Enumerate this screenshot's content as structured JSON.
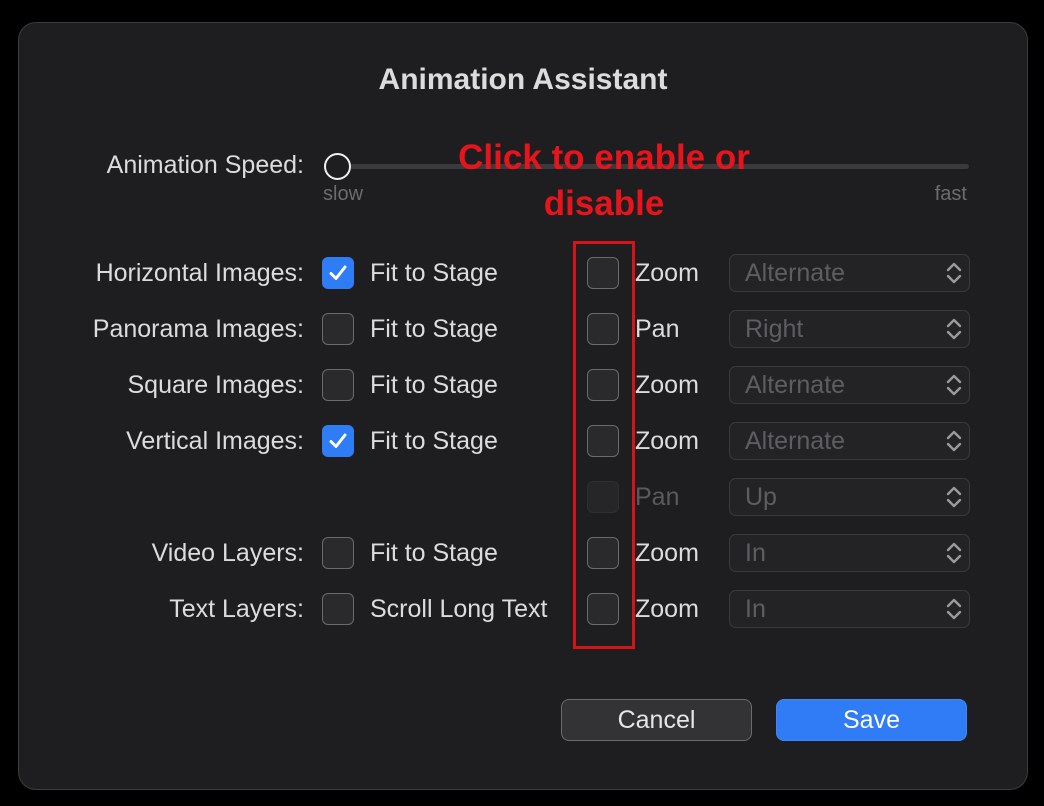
{
  "dialog": {
    "title": "Animation Assistant",
    "speed_label": "Animation Speed:",
    "speed_min_label": "slow",
    "speed_max_label": "fast",
    "speed_value": 0.0,
    "annotation": "Click to enable or disable",
    "rows": [
      {
        "label": "Horizontal Images:",
        "fit_label": "Fit to Stage",
        "fit_checked": true,
        "mode_checked": false,
        "mode_label": "Zoom",
        "select_value": "Alternate",
        "mode_disabled": false
      },
      {
        "label": "Panorama Images:",
        "fit_label": "Fit to Stage",
        "fit_checked": false,
        "mode_checked": false,
        "mode_label": "Pan",
        "select_value": "Right",
        "mode_disabled": false
      },
      {
        "label": "Square Images:",
        "fit_label": "Fit to Stage",
        "fit_checked": false,
        "mode_checked": false,
        "mode_label": "Zoom",
        "select_value": "Alternate",
        "mode_disabled": false
      },
      {
        "label": "Vertical Images:",
        "fit_label": "Fit to Stage",
        "fit_checked": true,
        "mode_checked": false,
        "mode_label": "Zoom",
        "select_value": "Alternate",
        "mode_disabled": false
      },
      {
        "label": "",
        "fit_label": "",
        "fit_checked": false,
        "mode_checked": false,
        "mode_label": "Pan",
        "select_value": "Up",
        "mode_disabled": true
      },
      {
        "label": "Video Layers:",
        "fit_label": "Fit to Stage",
        "fit_checked": false,
        "mode_checked": false,
        "mode_label": "Zoom",
        "select_value": "In",
        "mode_disabled": false
      },
      {
        "label": "Text Layers:",
        "fit_label": "Scroll Long Text",
        "fit_checked": false,
        "mode_checked": false,
        "mode_label": "Zoom",
        "select_value": "In",
        "mode_disabled": false
      }
    ],
    "cancel_label": "Cancel",
    "save_label": "Save"
  },
  "colors": {
    "accent": "#2e7cf6",
    "annotation": "#e8141c",
    "background": "#1e1e20"
  }
}
